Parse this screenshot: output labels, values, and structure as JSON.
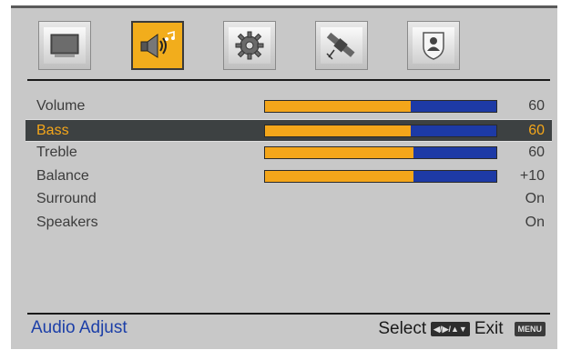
{
  "tabs": [
    {
      "icon": "tv-icon",
      "active": false
    },
    {
      "icon": "speaker-music-icon",
      "active": true
    },
    {
      "icon": "gear-icon",
      "active": false
    },
    {
      "icon": "satellite-icon",
      "active": false
    },
    {
      "icon": "parental-lock-icon",
      "active": false
    }
  ],
  "menu": {
    "items": [
      {
        "label": "Volume",
        "value": "60",
        "level": 0.63,
        "selected": false
      },
      {
        "label": "Bass",
        "value": "60",
        "level": 0.63,
        "selected": true
      },
      {
        "label": "Treble",
        "value": "60",
        "level": 0.64,
        "selected": false
      },
      {
        "label": "Balance",
        "value": "+10",
        "level": 0.64,
        "selected": false
      },
      {
        "label": "Surround",
        "value": "On"
      },
      {
        "label": "Speakers",
        "value": "On"
      }
    ]
  },
  "footer": {
    "title": "Audio Adjust",
    "select_label": "Select",
    "select_key": "◀/▶/▲▼",
    "exit_label": "Exit",
    "menu_key": "MENU"
  },
  "colors": {
    "accent": "#f4a61a",
    "bar_blue": "#1d3aa6",
    "selected_row": "#3d4142",
    "footer_title": "#1c3fa8"
  }
}
